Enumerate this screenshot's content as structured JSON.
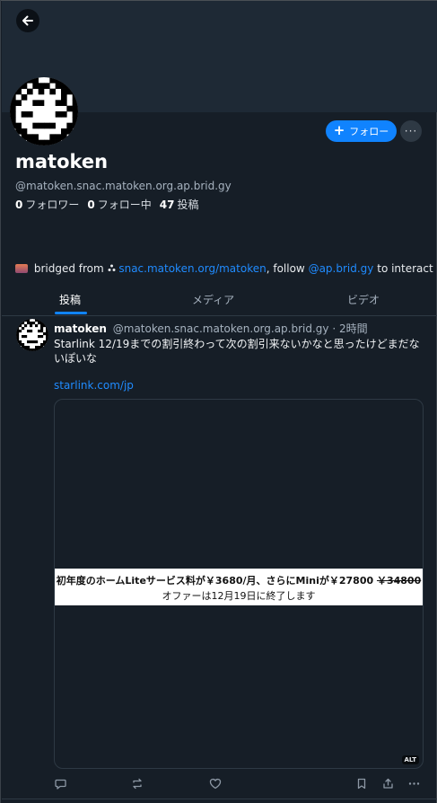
{
  "profile": {
    "name": "matoken",
    "handle": "@matoken.snac.matoken.org.ap.brid.gy",
    "followers_count": "0",
    "followers_label": "フォロワー",
    "following_count": "0",
    "following_label": "フォロー中",
    "posts_count": "47",
    "posts_label": "投稿",
    "follow_label": "フォロー",
    "more_label": "···"
  },
  "bio": {
    "prefix": "bridged from",
    "source_link": "snac.matoken.org/matoken",
    "middle": ", follow",
    "bridge_link": "@ap.brid.gy",
    "suffix": "to interact"
  },
  "tabs": [
    {
      "label": "投稿",
      "active": true
    },
    {
      "label": "メディア",
      "active": false
    },
    {
      "label": "ビデオ",
      "active": false
    }
  ],
  "post": {
    "author": "matoken",
    "handle": "@matoken.snac.matoken.org.ap.brid.gy",
    "separator": "·",
    "time": "2時間",
    "text": "Starlink 12/19までの割引終わって次の割引来ないかなと思ったけどまだないぽいな",
    "link": "starlink.com/jp",
    "image": {
      "line1_prefix": "初年度のホームLiteサービス料が￥3680/月、さらにMiniが￥27800",
      "line1_strike": "￥34800",
      "line2": "オファーは12月19日に終了します",
      "alt_badge": "ALT"
    }
  },
  "icons": {
    "back": "arrow-left-icon",
    "reply": "reply-icon",
    "repost": "repost-icon",
    "like": "heart-icon",
    "bookmark": "bookmark-icon",
    "share": "share-icon",
    "more": "more-icon"
  },
  "colors": {
    "background": "#161e27",
    "banner": "#1e2935",
    "accent": "#1083fe",
    "link": "#208bfe",
    "muted_text": "#a6b2bf"
  }
}
